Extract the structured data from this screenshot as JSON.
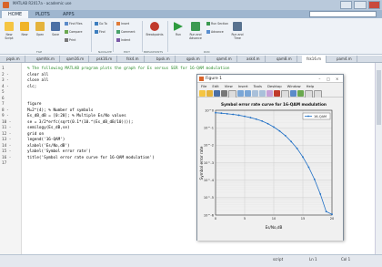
{
  "window": {
    "title": "MATLAB R2017a - academic use"
  },
  "toptabs": [
    {
      "label": "HOME",
      "active": true
    },
    {
      "label": "PLOTS",
      "active": false
    },
    {
      "label": "APPS",
      "active": false
    }
  ],
  "ribbon": {
    "file": [
      "New Script",
      "New",
      "Open",
      "Save",
      "Find Files",
      "Compare",
      "Print"
    ],
    "navigate": [
      "Go To",
      "Find"
    ],
    "edit": [
      "Insert",
      "Comment",
      "Indent"
    ],
    "breakpoints": "Breakpoints",
    "run": [
      "Run",
      "Run and Advance",
      "Run Section",
      "Advance",
      "Run and Time"
    ],
    "groups": [
      "FILE",
      "NAVIGATE",
      "EDIT",
      "BREAKPOINTS",
      "RUN"
    ]
  },
  "editor_tabs": [
    "pqsk.m",
    "qamfsk.m",
    "qam16.m",
    "psk16.m",
    "fsk4.m",
    "bpsk.m",
    "qpsk.m",
    "qam4.m",
    "ask4.m",
    "qam8.m",
    "fsk16.m",
    "pam4.m"
  ],
  "active_editor_tab": 10,
  "code": [
    {
      "n": "1",
      "text": "% The following MATLAB program plots the graph for Es versus SER for 16-QAM modulation",
      "cls": "c-com"
    },
    {
      "n": "2 -",
      "text": "clear all",
      "cls": "c-txt"
    },
    {
      "n": "3 -",
      "text": "close all",
      "cls": "c-txt"
    },
    {
      "n": "4 -",
      "text": "clc;",
      "cls": "c-txt"
    },
    {
      "n": "5",
      "text": "",
      "cls": "c-txt"
    },
    {
      "n": "6",
      "text": "",
      "cls": "c-txt"
    },
    {
      "n": "7",
      "text": "figure",
      "cls": "c-txt"
    },
    {
      "n": "8 -",
      "text": "M=2^(4); % Number of symbols",
      "cls": "c-txt"
    },
    {
      "n": "9 -",
      "text": "Es_dB_dB = [0:20]; % Multiple Es/No values",
      "cls": "c-txt"
    },
    {
      "n": "10 -",
      "text": "se = 3/2*erfc(sqrt(0.1*(10.^(Es_dB_dB/10))));",
      "cls": "c-txt"
    },
    {
      "n": "11 -",
      "text": "semilogy(Es_dB,se)",
      "cls": "c-txt"
    },
    {
      "n": "12 -",
      "text": "grid on",
      "cls": "c-txt"
    },
    {
      "n": "13 -",
      "text": "legend('16-QAM')",
      "cls": "c-txt"
    },
    {
      "n": "14 -",
      "text": "xlabel('Es/No,dB')",
      "cls": "c-txt"
    },
    {
      "n": "15 -",
      "text": "ylabel('Symbol error rate')",
      "cls": "c-txt"
    },
    {
      "n": "16 -",
      "text": "title('Symbol error rate curve for 16-QAM modulation')",
      "cls": "c-txt"
    },
    {
      "n": "17",
      "text": "",
      "cls": "c-txt"
    }
  ],
  "figure": {
    "title": "Figure 1",
    "menu": [
      "File",
      "Edit",
      "View",
      "Insert",
      "Tools",
      "Desktop",
      "Window",
      "Help"
    ]
  },
  "chart_data": {
    "type": "line",
    "title": "Symbol error rate curve for 16-QAM modulation",
    "xlabel": "Es/No,dB",
    "ylabel": "Symbol error rate",
    "yscale": "log",
    "xlim": [
      0,
      20
    ],
    "xticks": [
      "0",
      "5",
      "10",
      "15",
      "20"
    ],
    "ylim": [
      1e-06,
      1
    ],
    "yticks": [
      "10^0",
      "10^-1",
      "10^-2",
      "10^-3",
      "10^-4",
      "10^-5",
      "10^-6"
    ],
    "grid": true,
    "legend_position": "top-right",
    "series": [
      {
        "name": "16-QAM",
        "color": "#1f6fc5",
        "marker": "dot",
        "x": [
          0,
          1,
          2,
          3,
          4,
          5,
          6,
          7,
          8,
          9,
          10,
          11,
          12,
          13,
          14,
          15,
          16,
          17,
          18,
          19,
          20
        ],
        "y": [
          0.72,
          0.68,
          0.63,
          0.58,
          0.52,
          0.45,
          0.38,
          0.31,
          0.24,
          0.17,
          0.11,
          0.065,
          0.035,
          0.016,
          0.0065,
          0.0021,
          0.00055,
          0.00011,
          1.6e-05,
          1.6e-06,
          1.1e-06
        ]
      }
    ]
  },
  "status": {
    "text": "Ln 1",
    "encoding": "script",
    "position": "Col 1"
  }
}
